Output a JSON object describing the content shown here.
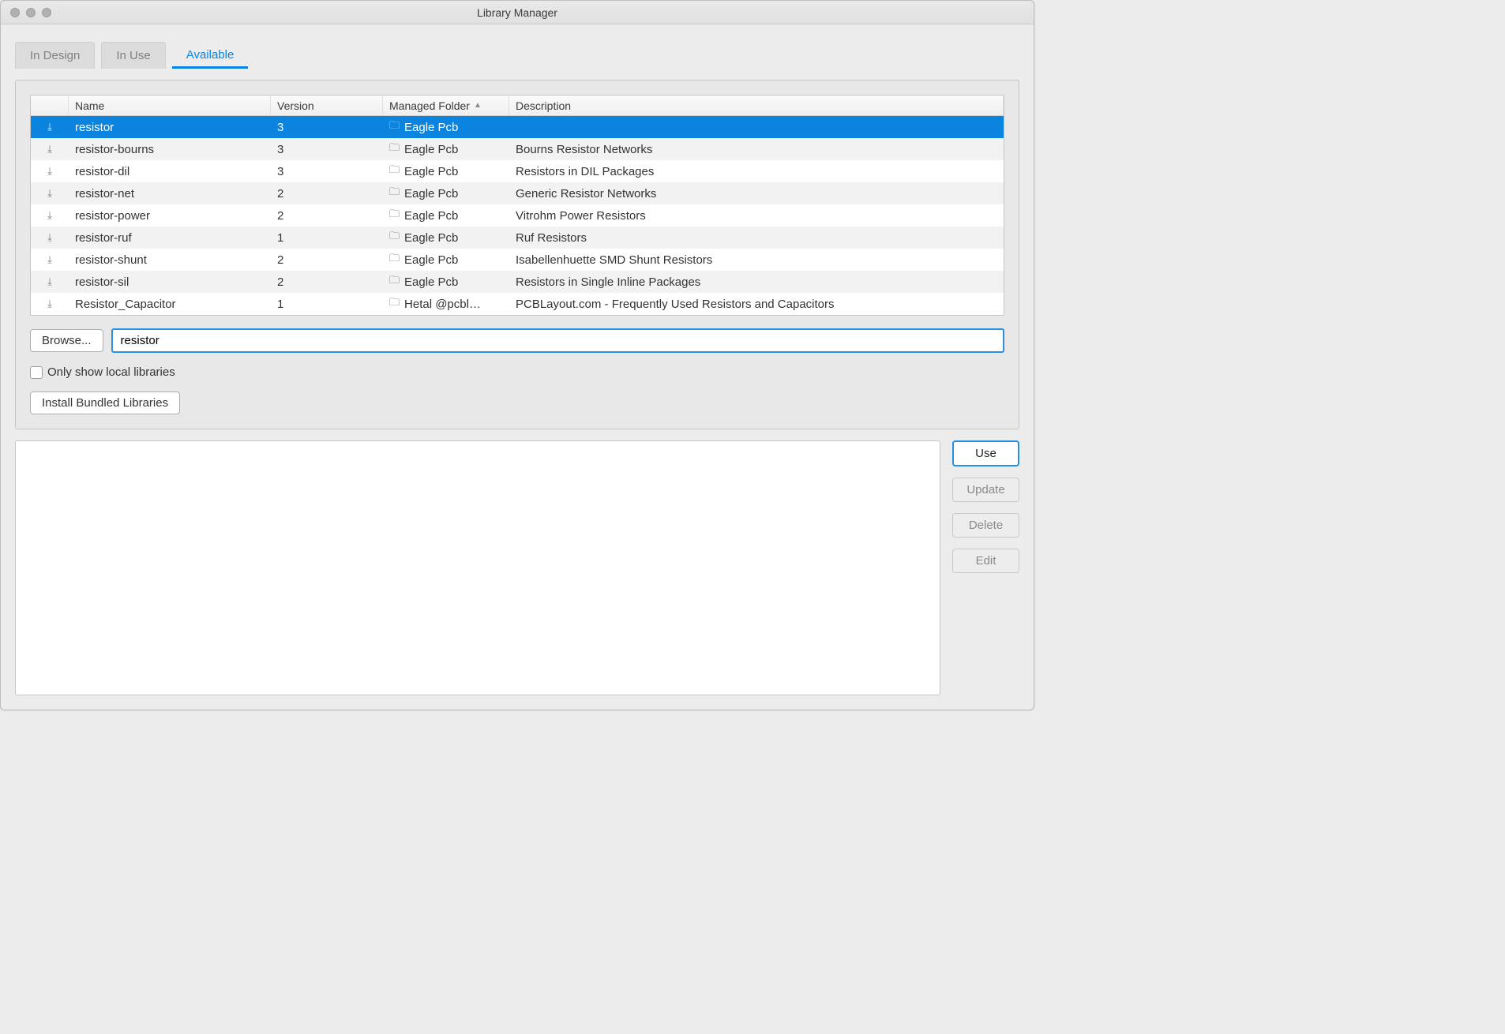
{
  "window": {
    "title": "Library Manager"
  },
  "tabs": {
    "in_design": "In Design",
    "in_use": "In Use",
    "available": "Available"
  },
  "columns": {
    "name": "Name",
    "version": "Version",
    "managed_folder": "Managed Folder",
    "description": "Description"
  },
  "rows": [
    {
      "name": "resistor",
      "version": "3",
      "folder": "Eagle Pcb",
      "description": "",
      "selected": true
    },
    {
      "name": "resistor-bourns",
      "version": "3",
      "folder": "Eagle Pcb",
      "description": "Bourns Resistor Networks",
      "selected": false
    },
    {
      "name": "resistor-dil",
      "version": "3",
      "folder": "Eagle Pcb",
      "description": "Resistors in DIL Packages",
      "selected": false
    },
    {
      "name": "resistor-net",
      "version": "2",
      "folder": "Eagle Pcb",
      "description": "Generic Resistor Networks",
      "selected": false
    },
    {
      "name": "resistor-power",
      "version": "2",
      "folder": "Eagle Pcb",
      "description": "Vitrohm Power Resistors",
      "selected": false
    },
    {
      "name": "resistor-ruf",
      "version": "1",
      "folder": "Eagle Pcb",
      "description": "Ruf Resistors",
      "selected": false
    },
    {
      "name": "resistor-shunt",
      "version": "2",
      "folder": "Eagle Pcb",
      "description": "Isabellenhuette SMD Shunt Resistors",
      "selected": false
    },
    {
      "name": "resistor-sil",
      "version": "2",
      "folder": "Eagle Pcb",
      "description": "Resistors in Single Inline Packages",
      "selected": false
    },
    {
      "name": "Resistor_Capacitor",
      "version": "1",
      "folder": "Hetal @pcbl…",
      "description": "PCBLayout.com - Frequently Used Resistors and Capacitors",
      "selected": false
    }
  ],
  "browse_label": "Browse...",
  "search_value": "resistor",
  "only_local_label": "Only show local libraries",
  "install_bundled_label": "Install Bundled Libraries",
  "buttons": {
    "use": "Use",
    "update": "Update",
    "delete": "Delete",
    "edit": "Edit"
  }
}
